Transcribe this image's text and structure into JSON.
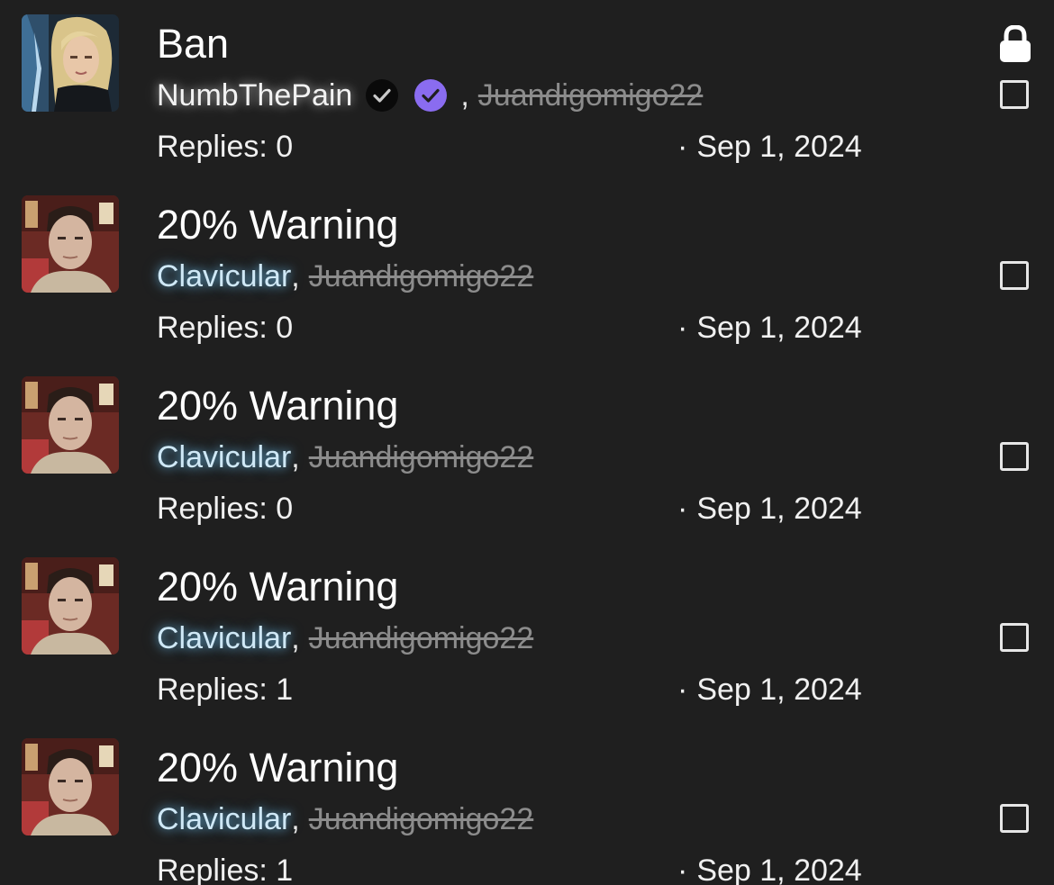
{
  "threads": [
    {
      "title": "Ban",
      "author": "NumbThePain",
      "last_user": "Juandigomigo22",
      "replies": "Replies: 0",
      "date": "Sep 1, 2024",
      "locked": true,
      "avatar": "woman-blonde-avatar"
    },
    {
      "title": "20% Warning",
      "author": "Clavicular",
      "last_user": "Juandigomigo22",
      "replies": "Replies: 0",
      "date": "Sep 1, 2024",
      "locked": false,
      "avatar": "man-selfie-avatar"
    },
    {
      "title": "20% Warning",
      "author": "Clavicular",
      "last_user": "Juandigomigo22",
      "replies": "Replies: 0",
      "date": "Sep 1, 2024",
      "locked": false,
      "avatar": "man-selfie-avatar"
    },
    {
      "title": "20% Warning",
      "author": "Clavicular",
      "last_user": "Juandigomigo22",
      "replies": "Replies: 1",
      "date": "Sep 1, 2024",
      "locked": false,
      "avatar": "man-selfie-avatar"
    },
    {
      "title": "20% Warning",
      "author": "Clavicular",
      "last_user": "Juandigomigo22",
      "replies": "Replies: 1",
      "date": "Sep 1, 2024",
      "locked": false,
      "avatar": "man-selfie-avatar"
    }
  ],
  "separator_comma": ",",
  "date_dot": "·",
  "badges": {
    "black_check": "black-verified-check-icon",
    "purple_check": "purple-verified-check-icon",
    "lock": "lock-icon"
  },
  "colors": {
    "background": "#1f1f1f",
    "author_glow": "#6ebeeb",
    "purple_badge": "#8a6cf0",
    "muted_text": "#8c8c8c"
  }
}
